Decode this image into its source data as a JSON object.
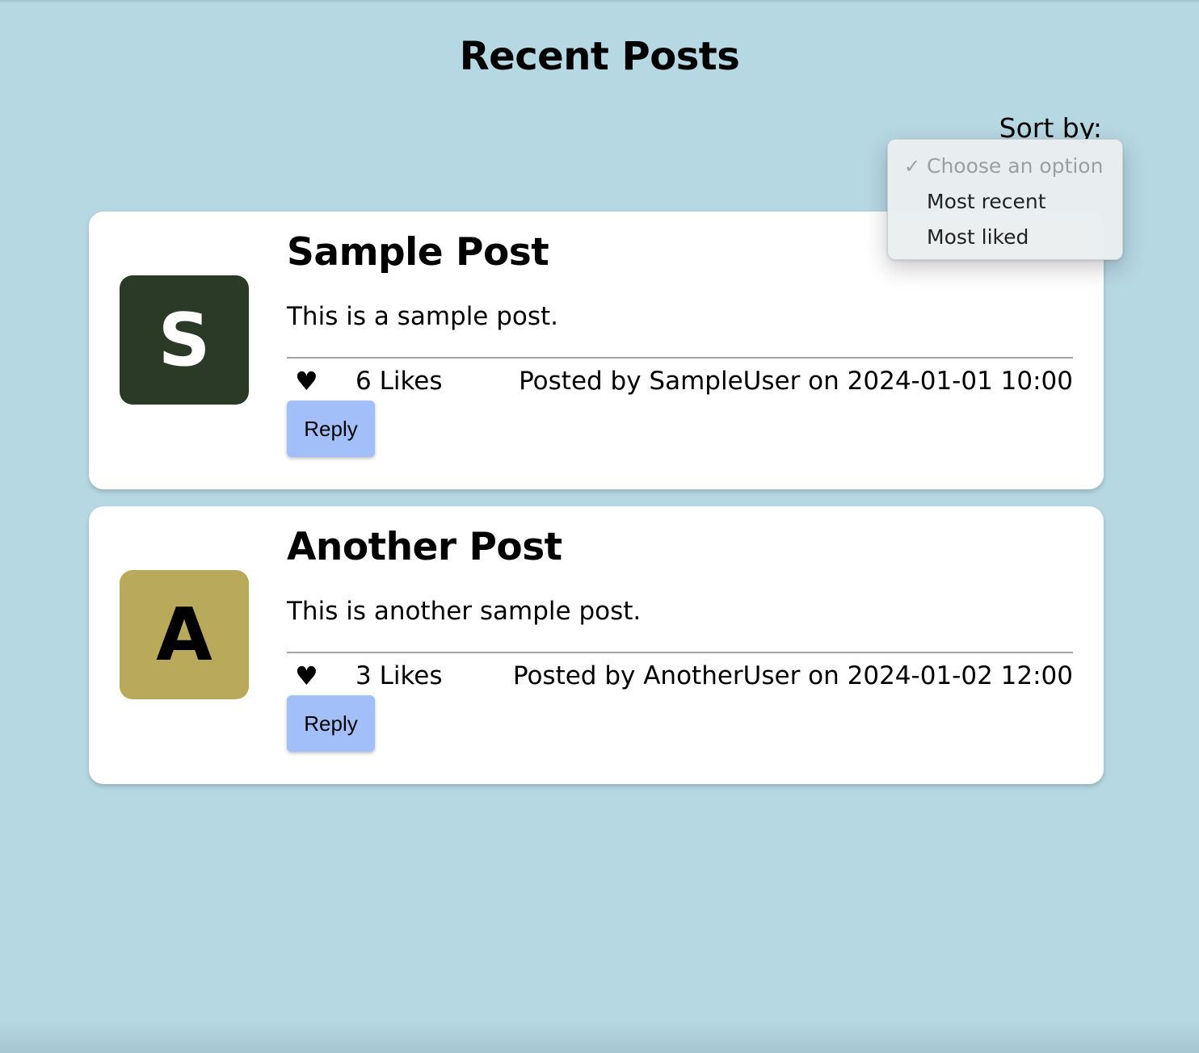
{
  "page": {
    "title": "Recent Posts",
    "background_color": "#b6d8e3"
  },
  "sort": {
    "label": "Sort by:",
    "options": [
      {
        "label": "Choose an option",
        "selected": true,
        "disabled": true
      },
      {
        "label": "Most recent",
        "selected": false,
        "disabled": false
      },
      {
        "label": "Most liked",
        "selected": false,
        "disabled": false
      }
    ]
  },
  "posts": [
    {
      "avatar_letter": "S",
      "avatar_bg": "#2b3a26",
      "avatar_fg": "#ffffff",
      "title": "Sample Post",
      "body": "This is a sample post.",
      "heart_icon": "heart-icon",
      "likes": "6 Likes",
      "meta": "Posted by SampleUser on 2024-01-01 10:00",
      "reply_label": "Reply"
    },
    {
      "avatar_letter": "A",
      "avatar_bg": "#b8aa5a",
      "avatar_fg": "#000000",
      "title": "Another Post",
      "body": "This is another sample post.",
      "heart_icon": "heart-icon",
      "likes": "3 Likes",
      "meta": "Posted by AnotherUser on 2024-01-02 12:00",
      "reply_label": "Reply"
    }
  ],
  "colors": {
    "card_bg": "#ffffff",
    "reply_button_bg": "#a2bffa",
    "divider": "#a4a4a4"
  }
}
